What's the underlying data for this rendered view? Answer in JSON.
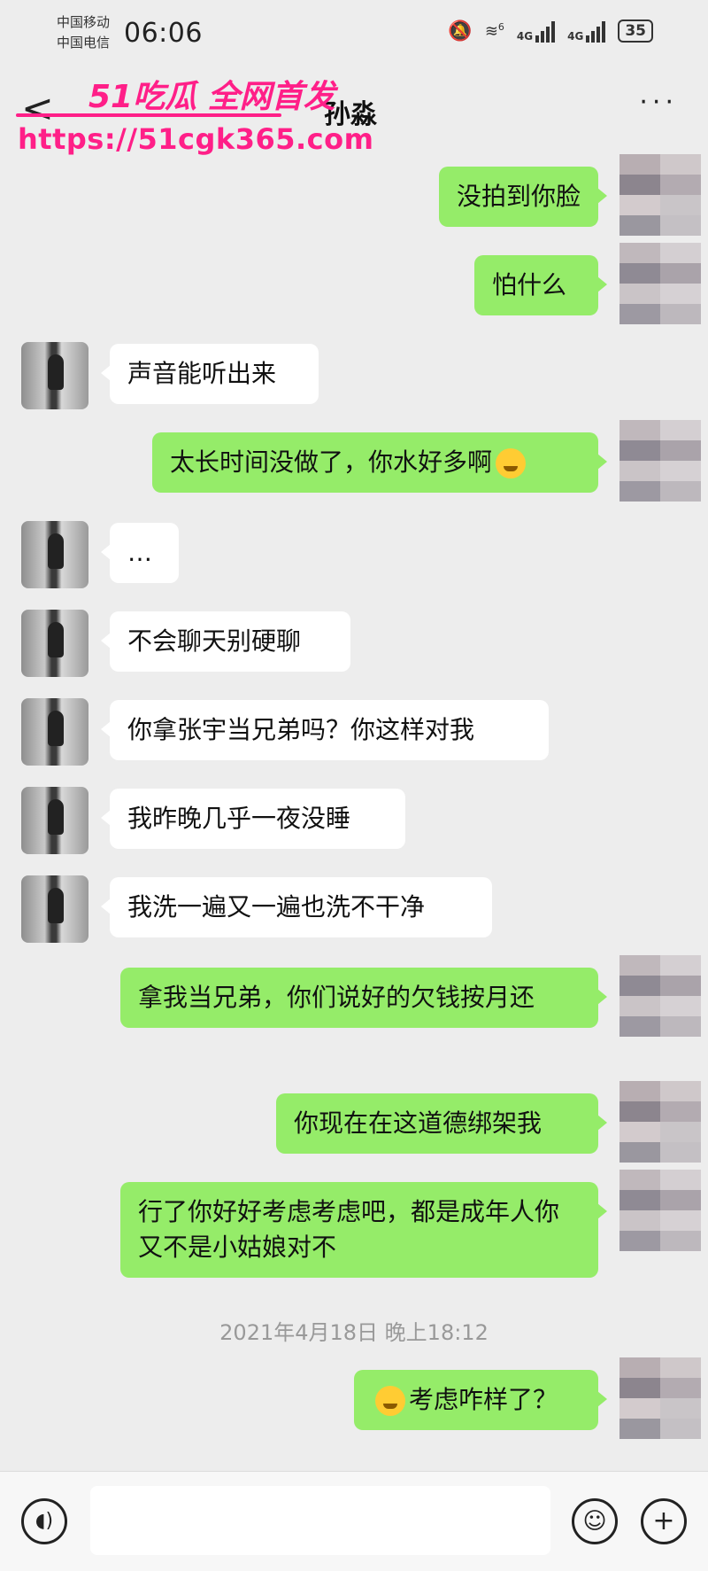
{
  "status_bar": {
    "carrier_1": "中国移动",
    "carrier_2": "中国电信",
    "time": "06:06",
    "wifi_label": "6",
    "net_1": "4G",
    "net_2": "4G",
    "battery": "35"
  },
  "header": {
    "back_glyph": "<",
    "title": "孙淼",
    "more_glyph": "···"
  },
  "watermark": {
    "line1": "51吃瓜 全网首发",
    "line2": "https://51cgk365.com"
  },
  "messages": [
    {
      "side": "out",
      "text": "没拍到你脸"
    },
    {
      "side": "out",
      "text": "怕什么"
    },
    {
      "side": "in",
      "text": "声音能听出来"
    },
    {
      "side": "out",
      "text": "太长时间没做了，你水好多啊",
      "emoji": "smirk-face"
    },
    {
      "side": "in",
      "text": "…"
    },
    {
      "side": "in",
      "text": "不会聊天别硬聊"
    },
    {
      "side": "in",
      "text": "你拿张宇当兄弟吗？你这样对我"
    },
    {
      "side": "in",
      "text": "我昨晚几乎一夜没睡"
    },
    {
      "side": "in",
      "text": "我洗一遍又一遍也洗不干净"
    },
    {
      "side": "out",
      "text": "拿我当兄弟，你们说好的欠钱按月还"
    },
    {
      "side": "out",
      "text": "你现在在这道德绑架我"
    },
    {
      "side": "out",
      "text": "行了你好好考虑考虑吧，都是成年人你又不是小姑娘对不"
    },
    {
      "side": "out",
      "text": "考虑咋样了？",
      "emoji": "teary-face"
    }
  ],
  "timestamp": "2021年4月18日 晚上18:12",
  "bottom_bar": {
    "voice_icon": "voice-icon",
    "emoji_icon": "emoji-icon",
    "plus_glyph": "+"
  },
  "colors": {
    "background": "#ededed",
    "outgoing_bubble": "#95ec69",
    "incoming_bubble": "#ffffff",
    "watermark": "#ff1f88"
  }
}
